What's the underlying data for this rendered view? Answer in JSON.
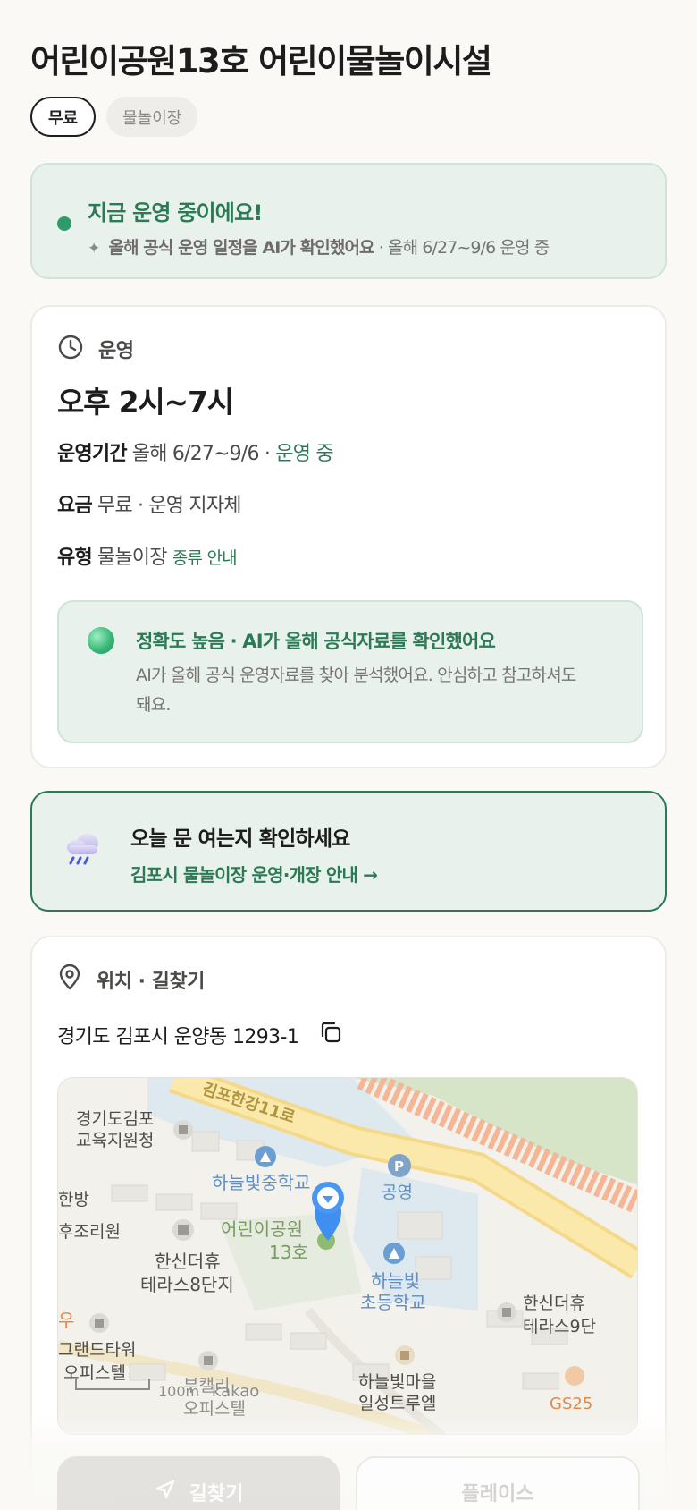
{
  "place": {
    "title": "어린이공원13호 어린이물놀이시설",
    "chips": {
      "fee": "무료",
      "type": "물놀이장"
    }
  },
  "status": {
    "title": "지금 운영 중이에요!",
    "ai_note": "올해 공식 운영 일정을 AI가 확인했어요",
    "ai_detail": " · 올해 6/27~9/6 운영 중",
    "dot_color": "#2e9b6a",
    "icon": "sparkle-icon"
  },
  "hours": {
    "section_label": "운영",
    "icon": "clock-icon",
    "main": "오후 2시~7시",
    "period_key": "운영기간",
    "period_value": "올해 6/27~9/6 · ",
    "period_status": "운영 중",
    "fee_key": "요금",
    "fee_value": "무료 · 운영 지자체",
    "type_key": "유형",
    "type_value": "물놀이장 ",
    "type_link": "종류 안내",
    "accuracy_title": "정확도 높음 · AI가 올해 공식자료를 확인했어요",
    "accuracy_desc": "AI가 올해 공식 운영자료를 찾아 분석했어요. 안심하고 참고하셔도 돼요."
  },
  "notice": {
    "icon": "rain-cloud-icon",
    "title": "오늘 문 여는지 확인하세요",
    "link": "김포시 물놀이장 운영·개장 안내 →"
  },
  "location": {
    "section_label": "위치 · 길찾기",
    "icon": "map-pin-icon",
    "address": "경기도 김포시 운양동 1293-1",
    "copy_icon": "copy-icon",
    "map": {
      "road_label": "김포한강11로",
      "labels": {
        "office_1": "경기도김포",
        "office_2": "교육지원청",
        "school_mid": "하늘빛중학교",
        "parking_label": "공영",
        "park_1": "어린이공원",
        "park_2": "13호",
        "left_1": "한방",
        "left_2": "후조리원",
        "apt_1": "한신더휴",
        "apt_2": "테라스8단지",
        "elem_1": "하늘빛",
        "elem_2": "초등학교",
        "apt_right_1": "한신더휴",
        "apt_right_2": "테라스9단",
        "office_bl_1": "그랜드타워",
        "office_bl_2": "오피스텔",
        "left_orange": "우",
        "village_1": "하늘빛마을",
        "village_2": "일성트루엘",
        "bottom_1": "부캘리",
        "bottom_2": "오피스텔",
        "store": "GS25",
        "scale": "100m",
        "brand": "kakao"
      }
    }
  },
  "actions": {
    "directions": "길찾기",
    "place_info": "플레이스"
  }
}
